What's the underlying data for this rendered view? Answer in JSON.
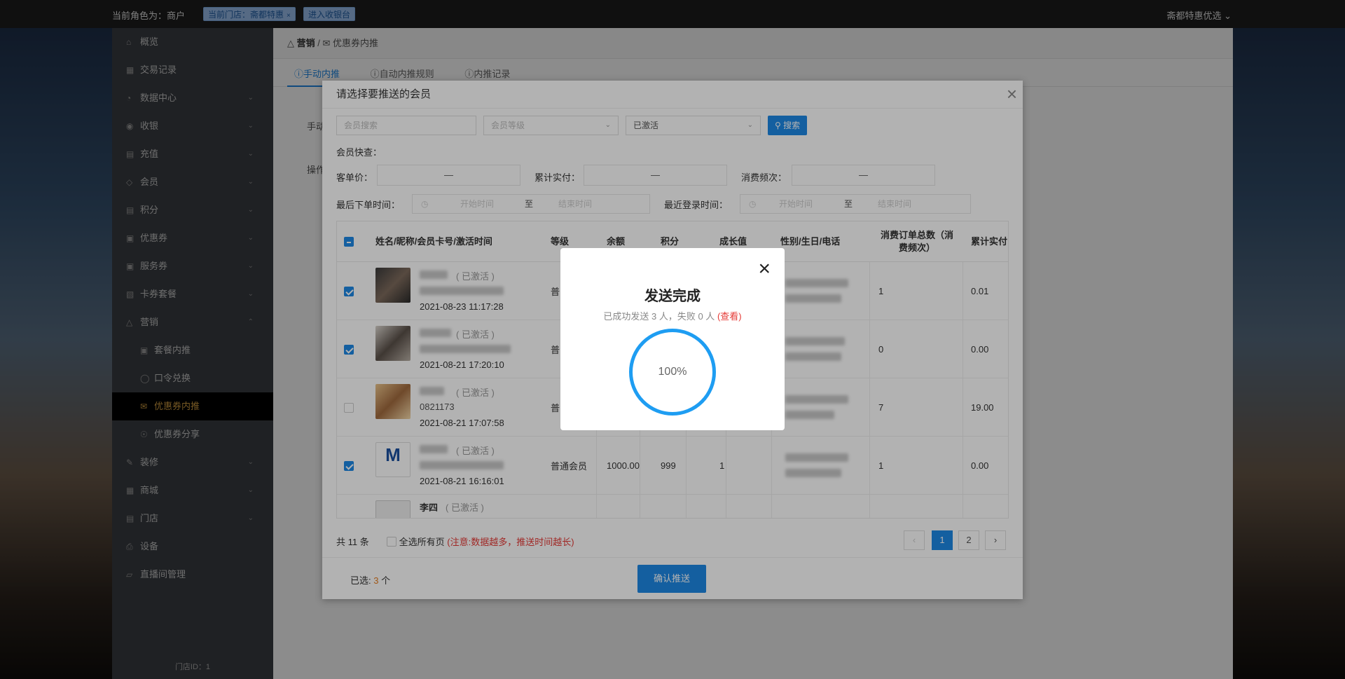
{
  "topbar": {
    "role": "当前角色为：商户",
    "store_tag": "当前门店：斋都特惠",
    "store_tag_close": "×",
    "cashier_tag": "进入收银台",
    "user": "斋都特惠优选"
  },
  "sidebar": {
    "items": [
      {
        "label": "概览",
        "icon": "home-icon"
      },
      {
        "label": "交易记录",
        "icon": "grid-icon"
      },
      {
        "label": "数据中心",
        "icon": "pie-icon"
      },
      {
        "label": "收银",
        "icon": "circle-icon"
      },
      {
        "label": "充值",
        "icon": "wallet-icon"
      },
      {
        "label": "会员",
        "icon": "diamond-icon"
      },
      {
        "label": "积分",
        "icon": "points-icon"
      },
      {
        "label": "优惠券",
        "icon": "ticket-icon"
      },
      {
        "label": "服务券",
        "icon": "ticket-icon"
      },
      {
        "label": "卡券套餐",
        "icon": "card-icon"
      },
      {
        "label": "营销",
        "icon": "marketing-icon"
      },
      {
        "label": "套餐内推",
        "icon": "package-icon"
      },
      {
        "label": "口令兑换",
        "icon": "key-icon"
      },
      {
        "label": "优惠券内推",
        "icon": "coupon-icon"
      },
      {
        "label": "优惠券分享",
        "icon": "share-icon"
      },
      {
        "label": "装修",
        "icon": "edit-icon"
      },
      {
        "label": "商城",
        "icon": "shop-icon"
      },
      {
        "label": "门店",
        "icon": "store-icon"
      },
      {
        "label": "设备",
        "icon": "printer-icon"
      },
      {
        "label": "直播间管理",
        "icon": "live-icon"
      }
    ],
    "store_id": "门店ID：1"
  },
  "breadcrumb": {
    "root": "营销",
    "sep": "/",
    "current": "优惠券内推"
  },
  "tabs": [
    "手动内推",
    "自动内推规则",
    "内推记录"
  ],
  "form_labels": {
    "manual": "手动",
    "op": "操作"
  },
  "dialog": {
    "title": "请选择要推送的会员",
    "close": "×",
    "search_placeholder": "会员搜索",
    "level_placeholder": "会员等级",
    "status_value": "已激活",
    "search_btn": "搜索",
    "quick": "会员快查：",
    "avg_label": "客单价：",
    "total_label": "累计实付：",
    "freq_label": "消费频次：",
    "dash": "—",
    "last_order_label": "最后下单时间：",
    "last_login_label": "最近登录时间：",
    "start": "开始时间",
    "to": "至",
    "end": "结束时间",
    "headers": [
      "姓名/昵称/会员卡号/激活时间",
      "等级",
      "余额",
      "积分",
      "成长值",
      "性别/生日/电话",
      "消费订单总数（消费频次）",
      "累计实付"
    ],
    "rows": [
      {
        "status": "( 已激活 )",
        "date": "2021-08-23 11:17:28",
        "level": "普",
        "balance": "",
        "points": "",
        "growth": "",
        "orders": "1",
        "paid": "0.01",
        "checked": true
      },
      {
        "status": "( 已激活 )",
        "date": "2021-08-21 17:20:10",
        "level": "普",
        "balance": "",
        "points": "",
        "growth": "",
        "orders": "0",
        "paid": "0.00",
        "checked": true
      },
      {
        "status": "( 已激活 )",
        "date": "2021-08-21 17:07:58",
        "level": "普",
        "balance": "",
        "points": "",
        "growth": "",
        "orders": "7",
        "paid": "19.00",
        "checked": false
      },
      {
        "status": "( 已激活 )",
        "date": "2021-08-21 16:16:01",
        "level": "普通会员",
        "balance": "1000.00",
        "points": "999",
        "growth": "1",
        "orders": "1",
        "paid": "0.00",
        "checked": true
      },
      {
        "name": "李四",
        "status": "( 已激活 )",
        "date": "",
        "level": "",
        "balance": "",
        "points": "",
        "growth": "",
        "orders": "",
        "paid": "",
        "checked": false
      }
    ],
    "row3_card_partial": "0821173",
    "total": "共 11 条",
    "select_all": "全选所有页",
    "note": "(注意:数据越多，推送时间越长)",
    "pages": [
      "1",
      "2"
    ],
    "current_page": "1",
    "selected_prefix": "已选: ",
    "selected_count": "3",
    "selected_suffix": " 个",
    "confirm": "确认推送"
  },
  "result_modal": {
    "title": "发送完成",
    "success_text": "已成功发送 3 人，失败 0 人",
    "view_link": "(查看)",
    "progress_label": "100%",
    "progress": 1.0,
    "close": "×"
  },
  "colors": {
    "accent": "#1e88e5",
    "ring": "#1e9df2",
    "warning": "#e53935",
    "active_nav": "#d9a343"
  }
}
